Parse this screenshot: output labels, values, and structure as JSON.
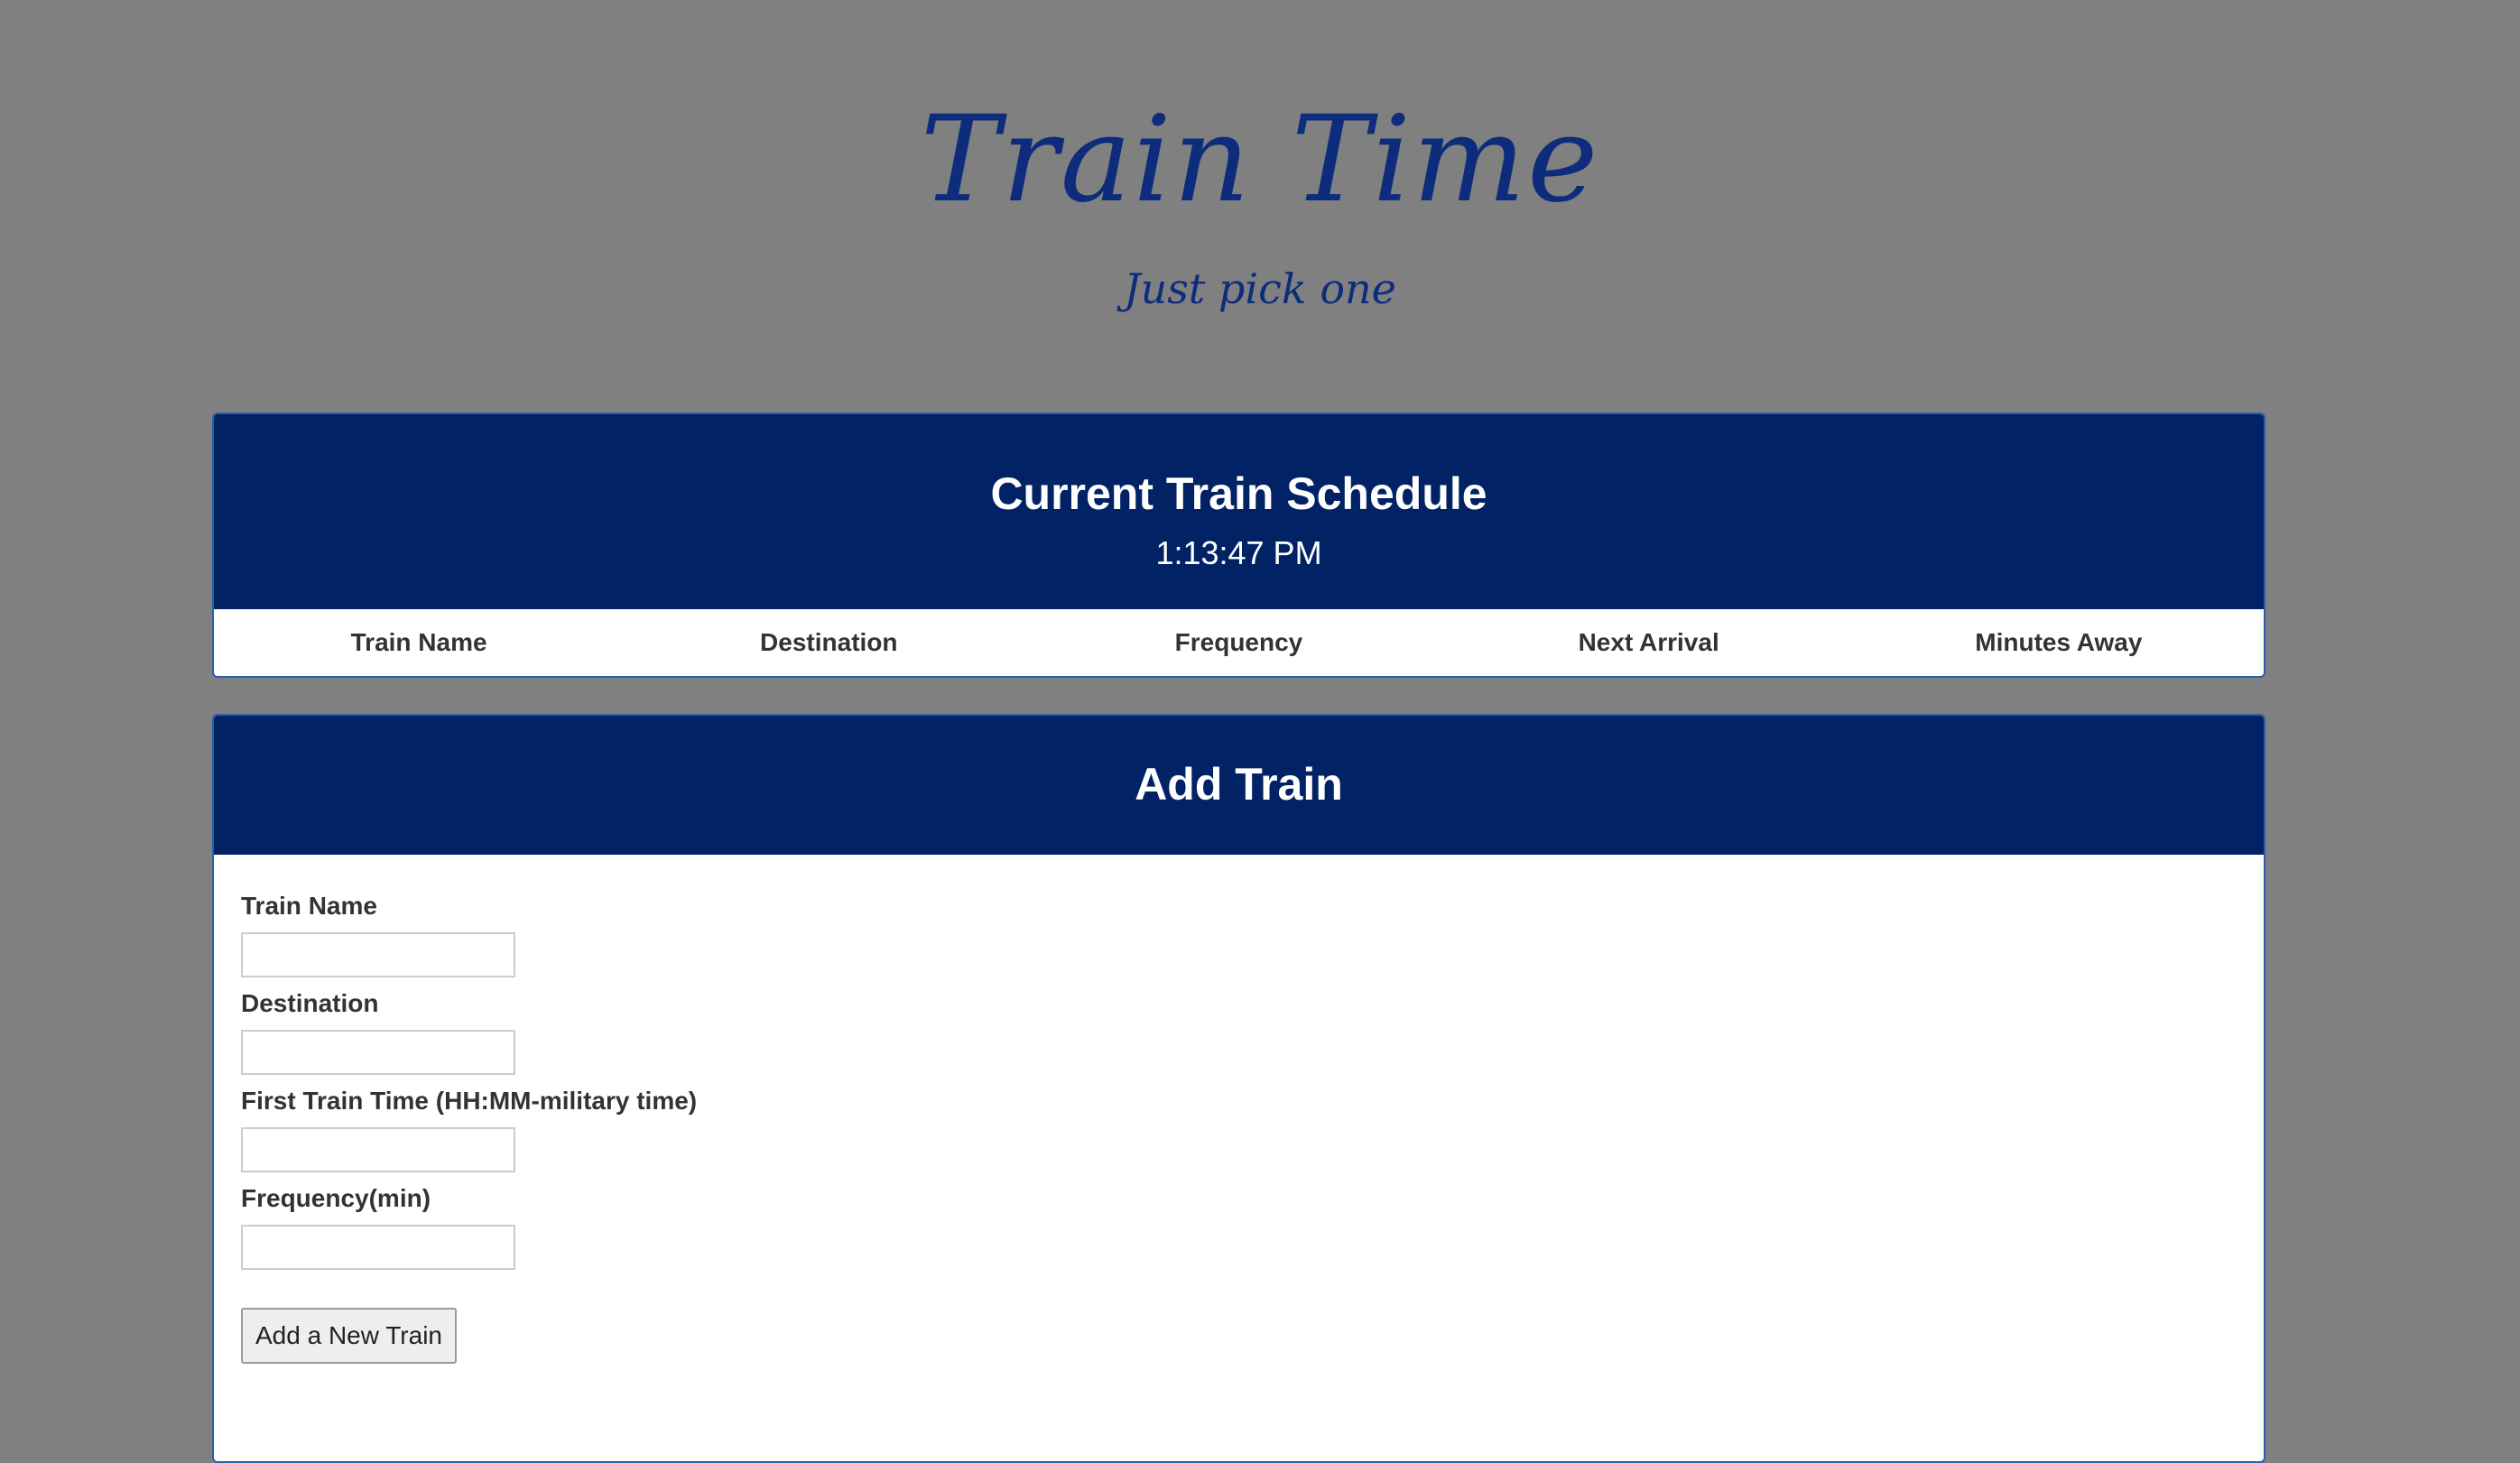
{
  "header": {
    "title": "Train Time",
    "subtitle": "Just pick one"
  },
  "schedule": {
    "title": "Current Train Schedule",
    "clock": "1:13:47 PM",
    "columns": [
      "Train Name",
      "Destination",
      "Frequency",
      "Next Arrival",
      "Minutes Away"
    ]
  },
  "add_train": {
    "title": "Add Train",
    "fields": [
      {
        "label": "Train Name",
        "value": "",
        "placeholder": ""
      },
      {
        "label": "Destination",
        "value": "",
        "placeholder": ""
      },
      {
        "label": "First Train Time (HH:MM-military time)",
        "value": "",
        "placeholder": ""
      },
      {
        "label": "Frequency(min)",
        "value": "",
        "placeholder": ""
      }
    ],
    "submit_label": "Add a New Train"
  },
  "colors": {
    "background": "#808080",
    "panel_heading": "#012365",
    "title_text": "#0d2c7c"
  }
}
